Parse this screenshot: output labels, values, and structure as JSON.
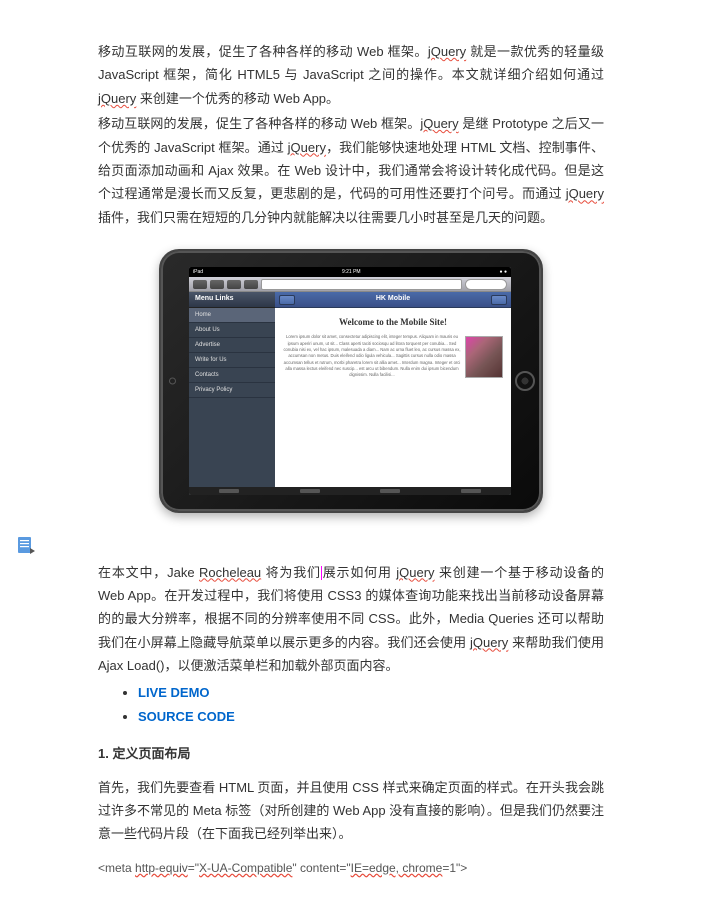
{
  "para1_parts": [
    {
      "t": "移动互联网的发展，促生了各种各样的移动 Web 框架。",
      "u": false
    },
    {
      "t": "jQuery",
      "u": true
    },
    {
      "t": " 就是一款优秀的轻量级 JavaScript 框架，简化 HTML5 与 JavaScript 之间的操作。本文就详细介绍如何通过 ",
      "u": false
    },
    {
      "t": "jQuery",
      "u": true
    },
    {
      "t": " 来创建一个优秀的移动 Web App。",
      "u": false
    }
  ],
  "para2_parts": [
    {
      "t": "移动互联网的发展，促生了各种各样的移动 Web 框架。",
      "u": false
    },
    {
      "t": "jQuery",
      "u": true
    },
    {
      "t": " 是继 Prototype 之后又一个优秀的 JavaScript 框架。通过 ",
      "u": false
    },
    {
      "t": "jQuery",
      "u": true
    },
    {
      "t": "，我们能够快速地处理 HTML 文档、控制事件、给页面添加动画和 Ajax 效果。在 Web 设计中，我们通常会将设计转化成代码。但是这个过程通常是漫长而又反复，更悲剧的是，代码的可用性还要打个问号。而通过 ",
      "u": false
    },
    {
      "t": "jQuery",
      "u": true
    },
    {
      "t": " 插件，我们只需在短短的几分钟内就能解决以往需要几小时甚至是几天的问题。",
      "u": false
    }
  ],
  "ipad": {
    "status_left": "iPad",
    "status_center": "9:21 PM",
    "status_right": "● ●",
    "sidebar_title": "Menu Links",
    "sidebar_items": [
      "Home",
      "About Us",
      "Advertise",
      "Write for Us",
      "Contacts",
      "Privacy Policy"
    ],
    "main_title": "HK Mobile",
    "page_title": "Welcome to the Mobile Site!",
    "lorem": "Lorem ipsum dolor sit amet, consectetur adipiscing elit, integer tempus. Aliquam in mauris eu ipsum aperiri unum, ut sit... Class aperti taciti sociosqu ad litora torquent per conubia... Sed conubia nisi ex, vel hac ipsum, malesuada a diam... Nam ac urna fluet leo, ac cursus massa ex, accumsan non metus. Duis eleifend odio ligula vehicula... Sagittis cursus nulla odio massa accumsan tellus et rutrum, morbi pharetra lorem sit allia amet... Interdum magna. Integer et orci alla massa lectus eleifend nec suscip... est arcu ut bibendum. Nulla enim dui ipsum bicendum dignissim. Nulla facilisi..."
  },
  "para3_pre": "在本文中，Jake ",
  "para3_roch": "Rocheleau",
  "para3_mid1": " 将为我们",
  "para3_mid2": "展示如何用 ",
  "para3_jq": "jQuery",
  "para3_mid3": " 来创建一个基于移动设备的 Web App。在开发过程中，我们将使用 CSS3 的媒体查询功能来找出当前移动设备屏幕的的最大分辨率，根据不同的分辨率使用不同 CSS。此外，Media Queries 还可以帮助我们在小屏幕上隐藏导航菜单以展示更多的内容。我们还会使用 ",
  "para3_jq2": "jQuery",
  "para3_end": " 来帮助我们使用 Ajax Load()，以便激活菜单栏和加载外部页面内容。",
  "links": {
    "demo": "LIVE DEMO",
    "source": "SOURCE CODE"
  },
  "heading1": "1.  定义页面布局",
  "para4": "首先，我们先要查看 HTML 页面，并且使用 CSS 样式来确定页面的样式。在开头我会跳过许多不常见的 Meta 标签（对所创建的 Web App 没有直接的影响）。但是我们仍然要注意一些代码片段（在下面我已经列举出来）。",
  "code_parts": [
    {
      "t": "<meta ",
      "u": false
    },
    {
      "t": "http-equiv",
      "u": true
    },
    {
      "t": "=\"",
      "u": false
    },
    {
      "t": "X-UA-Compatible",
      "u": true
    },
    {
      "t": "\" content=\"",
      "u": false
    },
    {
      "t": "IE=edge, chrome",
      "u": true
    },
    {
      "t": "=1\">",
      "u": false
    }
  ]
}
